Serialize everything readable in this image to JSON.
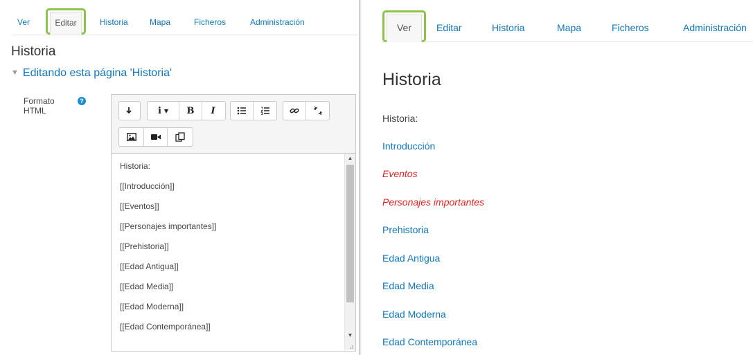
{
  "left": {
    "tabs": [
      {
        "label": "Ver",
        "active": false
      },
      {
        "label": "Editar",
        "active": true
      },
      {
        "label": "Historia",
        "active": false
      },
      {
        "label": "Mapa",
        "active": false
      },
      {
        "label": "Ficheros",
        "active": false
      },
      {
        "label": "Administración",
        "active": false
      }
    ],
    "page_title": "Historia",
    "section_title": "Editando esta página 'Historia'",
    "format_label_line1": "Formato",
    "format_label_line2": "HTML",
    "help_icon": "help-icon",
    "toolbar": {
      "row1": [
        "collapse-icon",
        "info-dropdown-icon",
        "bold-icon",
        "italic-icon",
        "bullet-list-icon",
        "numbered-list-icon",
        "link-icon",
        "unlink-icon"
      ],
      "row2": [
        "image-icon",
        "video-icon",
        "manage-files-icon"
      ],
      "bold_label": "B",
      "italic_label": "I",
      "info_label": "i"
    },
    "editor_lines": [
      "Historia:",
      "[[Introducción]]",
      "[[Eventos]]",
      "[[Personajes importantes]]",
      "[[Prehistoria]]",
      "[[Edad Antigua]]",
      "[[Edad Media]]",
      "[[Edad Moderna]]",
      "[[Edad Contemporánea]]"
    ]
  },
  "right": {
    "tabs": [
      {
        "label": "Ver",
        "active": true
      },
      {
        "label": "Editar",
        "active": false
      },
      {
        "label": "Historia",
        "active": false
      },
      {
        "label": "Mapa",
        "active": false
      },
      {
        "label": "Ficheros",
        "active": false
      },
      {
        "label": "Administración",
        "active": false
      }
    ],
    "page_title": "Historia",
    "prefix_text": "Historia:",
    "links": [
      {
        "label": "Introducción",
        "exists": true
      },
      {
        "label": "Eventos",
        "exists": false
      },
      {
        "label": "Personajes importantes",
        "exists": false
      },
      {
        "label": "Prehistoria",
        "exists": true
      },
      {
        "label": "Edad Antigua",
        "exists": true
      },
      {
        "label": "Edad Media",
        "exists": true
      },
      {
        "label": "Edad Moderna",
        "exists": true
      },
      {
        "label": "Edad Contemporánea",
        "exists": true
      }
    ]
  },
  "colors": {
    "link": "#1177bb",
    "missing_link": "#e32020",
    "highlight": "#8bc34a"
  }
}
